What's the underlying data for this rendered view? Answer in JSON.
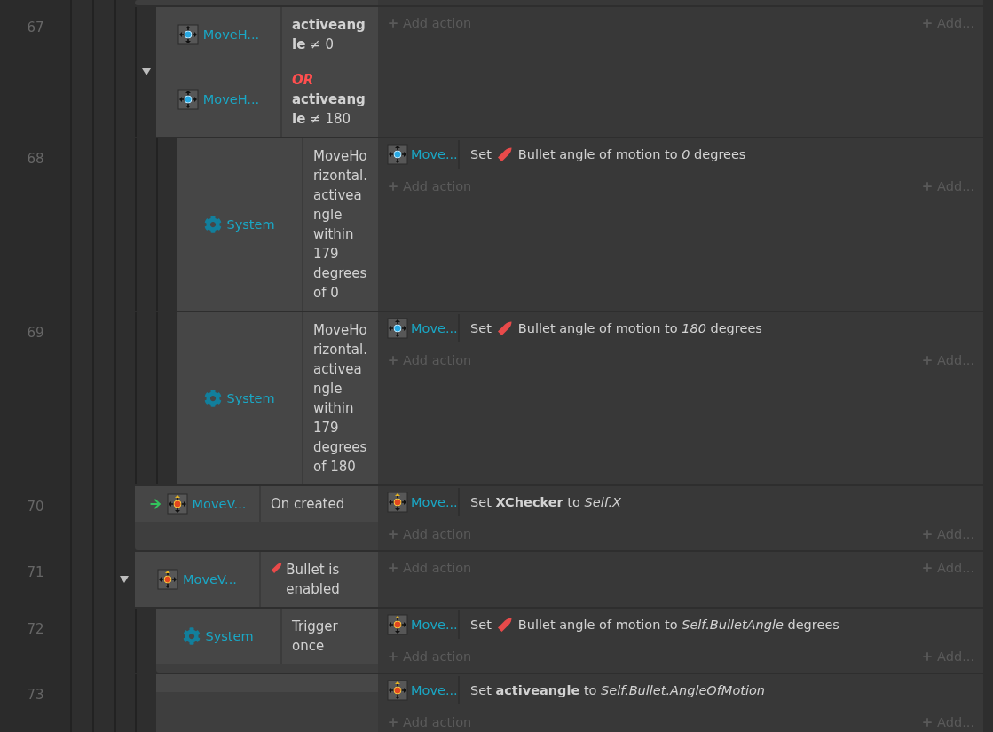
{
  "events": [
    {
      "kind": "continuation",
      "children": [
        {
          "kind": "event",
          "number": "67",
          "expanded": true,
          "conditions": [
            {
              "object": "MoveH...",
              "kind": "horizontal",
              "behavior_icon": false,
              "trigger": false,
              "text": "**activeangle** ≠ 0"
            },
            {
              "object": "MoveH...",
              "kind": "horizontal",
              "behavior_icon": false,
              "trigger": false,
              "or_label": "OR",
              "text": "**activeangle** ≠ 180"
            }
          ],
          "add_action": "Add action",
          "add_more": "Add...",
          "children": [
            {
              "kind": "event",
              "number": "68",
              "conditions": [
                {
                  "object": "System",
                  "kind": "system",
                  "behavior_icon": false,
                  "trigger": false,
                  "text": "MoveHorizontal.activeangle within 179 degrees of 0"
                }
              ],
              "actions": [
                {
                  "object": "Move...",
                  "kind": "horizontal",
                  "behavior_icon": true,
                  "verb": "Set",
                  "text": "Bullet angle of motion to *0* degrees"
                }
              ],
              "add_action": "Add action",
              "add_more": "Add..."
            },
            {
              "kind": "event",
              "number": "69",
              "conditions": [
                {
                  "object": "System",
                  "kind": "system",
                  "behavior_icon": false,
                  "trigger": false,
                  "text": "MoveHorizontal.activeangle within 179 degrees of 180"
                }
              ],
              "actions": [
                {
                  "object": "Move...",
                  "kind": "horizontal",
                  "behavior_icon": true,
                  "verb": "Set",
                  "text": "Bullet angle of motion to *180* degrees"
                }
              ],
              "add_action": "Add action",
              "add_more": "Add..."
            }
          ]
        }
      ]
    },
    {
      "kind": "event",
      "number": "70",
      "conditions": [
        {
          "object": "MoveV...",
          "kind": "vertical",
          "behavior_icon": false,
          "trigger": true,
          "text": "On created"
        }
      ],
      "actions": [
        {
          "object": "Move...",
          "kind": "vertical",
          "behavior_icon": false,
          "text": "Set **XChecker** to *Self.X*"
        }
      ],
      "add_action": "Add action",
      "add_more": "Add..."
    },
    {
      "kind": "event",
      "number": "71",
      "expanded": true,
      "conditions": [
        {
          "object": "MoveV...",
          "kind": "vertical",
          "behavior_icon": true,
          "trigger": false,
          "text": "Bullet is enabled"
        }
      ],
      "add_action": "Add action",
      "add_more": "Add...",
      "children": [
        {
          "kind": "event",
          "number": "72",
          "conditions": [
            {
              "object": "System",
              "kind": "system",
              "behavior_icon": false,
              "trigger": false,
              "text": "Trigger once"
            }
          ],
          "actions": [
            {
              "object": "Move...",
              "kind": "vertical",
              "behavior_icon": true,
              "verb": "Set",
              "text": "Bullet angle of motion to *Self.BulletAngle* degrees"
            }
          ],
          "add_action": "Add action",
          "add_more": "Add..."
        },
        {
          "kind": "event",
          "number": "73",
          "actions": [
            {
              "object": "Move...",
              "kind": "vertical",
              "behavior_icon": false,
              "text": "Set **activeangle** to *Self.Bullet.AngleOfMotion*"
            }
          ],
          "add_action": "Add action",
          "add_more": "Add..."
        }
      ]
    }
  ]
}
